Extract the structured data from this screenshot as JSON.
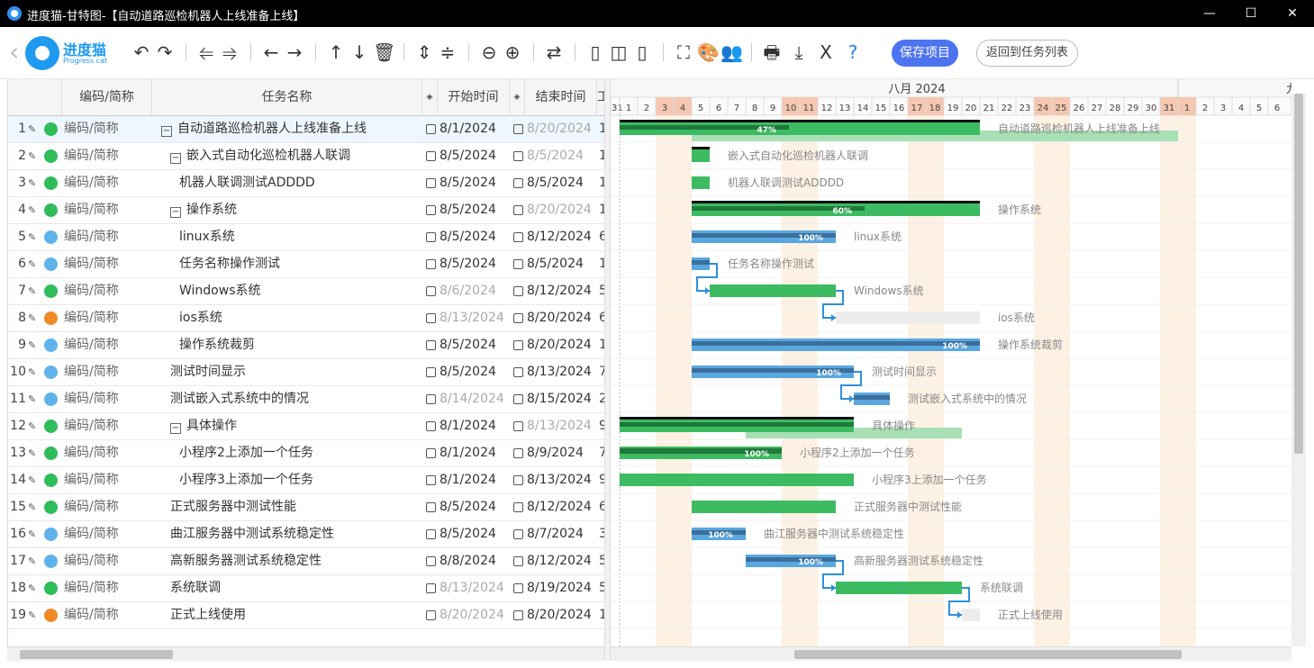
{
  "window": {
    "title": "进度猫-甘特图-【自动道路巡检机器人上线准备上线】",
    "controls": [
      "—",
      "☐",
      "✕"
    ]
  },
  "logo": {
    "name": "进度猫",
    "sub": "Progress cat"
  },
  "toolbar": {
    "save_label": "保存项目",
    "back_label": "返回到任务列表"
  },
  "grid": {
    "headers": [
      "编码/简称",
      "任务名称",
      "开始时间",
      "结束时间",
      "工"
    ]
  },
  "rows": [
    {
      "num": "1",
      "status": "#2ebd59",
      "code": "编码/简称",
      "name": "自动道路巡检机器人上线准备上线",
      "indent": 0,
      "toggle": "−",
      "start": "8/1/2024",
      "start_grey": false,
      "end": "8/20/2024",
      "end_grey": true,
      "work": "1",
      "selected": true
    },
    {
      "num": "2",
      "status": "#2ebd59",
      "code": "编码/简称",
      "name": "嵌入式自动化巡检机器人联调",
      "indent": 1,
      "toggle": "−",
      "start": "8/5/2024",
      "start_grey": false,
      "end": "8/5/2024",
      "end_grey": true,
      "work": "1"
    },
    {
      "num": "3",
      "status": "#2ebd59",
      "code": "编码/简称",
      "name": "机器人联调测试ADDDD",
      "indent": 2,
      "toggle": "",
      "start": "8/5/2024",
      "start_grey": false,
      "end": "8/5/2024",
      "end_grey": false,
      "work": "1"
    },
    {
      "num": "4",
      "status": "#2ebd59",
      "code": "编码/简称",
      "name": "操作系统",
      "indent": 1,
      "toggle": "−",
      "start": "8/5/2024",
      "start_grey": false,
      "end": "8/20/2024",
      "end_grey": true,
      "work": "1"
    },
    {
      "num": "5",
      "status": "#5fb3ea",
      "code": "编码/简称",
      "name": "linux系统",
      "indent": 2,
      "toggle": "",
      "start": "8/5/2024",
      "start_grey": false,
      "end": "8/12/2024",
      "end_grey": false,
      "work": "6"
    },
    {
      "num": "6",
      "status": "#5fb3ea",
      "code": "编码/简称",
      "name": "任务名称操作测试",
      "indent": 2,
      "toggle": "",
      "start": "8/5/2024",
      "start_grey": false,
      "end": "8/5/2024",
      "end_grey": false,
      "work": "1"
    },
    {
      "num": "7",
      "status": "#2ebd59",
      "code": "编码/简称",
      "name": "Windows系统",
      "indent": 2,
      "toggle": "",
      "start": "8/6/2024",
      "start_grey": true,
      "end": "8/12/2024",
      "end_grey": false,
      "work": "5"
    },
    {
      "num": "8",
      "status": "#f08a24",
      "code": "编码/简称",
      "name": "ios系统",
      "indent": 2,
      "toggle": "",
      "start": "8/13/2024",
      "start_grey": true,
      "end": "8/20/2024",
      "end_grey": false,
      "work": "6"
    },
    {
      "num": "9",
      "status": "#5fb3ea",
      "code": "编码/简称",
      "name": "操作系统裁剪",
      "indent": 2,
      "toggle": "",
      "start": "8/5/2024",
      "start_grey": false,
      "end": "8/20/2024",
      "end_grey": false,
      "work": "1"
    },
    {
      "num": "10",
      "status": "#5fb3ea",
      "code": "编码/简称",
      "name": "测试时间显示",
      "indent": 1,
      "toggle": "",
      "start": "8/5/2024",
      "start_grey": false,
      "end": "8/13/2024",
      "end_grey": false,
      "work": "7"
    },
    {
      "num": "11",
      "status": "#5fb3ea",
      "code": "编码/简称",
      "name": "测试嵌入式系统中的情况",
      "indent": 1,
      "toggle": "",
      "start": "8/14/2024",
      "start_grey": true,
      "end": "8/15/2024",
      "end_grey": false,
      "work": "2"
    },
    {
      "num": "12",
      "status": "#2ebd59",
      "code": "编码/简称",
      "name": "具体操作",
      "indent": 1,
      "toggle": "−",
      "start": "8/1/2024",
      "start_grey": false,
      "end": "8/13/2024",
      "end_grey": true,
      "work": "9"
    },
    {
      "num": "13",
      "status": "#2ebd59",
      "code": "编码/简称",
      "name": "小程序2上添加一个任务",
      "indent": 2,
      "toggle": "",
      "start": "8/1/2024",
      "start_grey": false,
      "end": "8/9/2024",
      "end_grey": false,
      "work": "7"
    },
    {
      "num": "14",
      "status": "#2ebd59",
      "code": "编码/简称",
      "name": "小程序3上添加一个任务",
      "indent": 2,
      "toggle": "",
      "start": "8/1/2024",
      "start_grey": false,
      "end": "8/13/2024",
      "end_grey": false,
      "work": "9"
    },
    {
      "num": "15",
      "status": "#2ebd59",
      "code": "编码/简称",
      "name": "正式服务器中测试性能",
      "indent": 1,
      "toggle": "",
      "start": "8/5/2024",
      "start_grey": false,
      "end": "8/12/2024",
      "end_grey": false,
      "work": "6"
    },
    {
      "num": "16",
      "status": "#5fb3ea",
      "code": "编码/简称",
      "name": "曲江服务器中测试系统稳定性",
      "indent": 1,
      "toggle": "",
      "start": "8/5/2024",
      "start_grey": false,
      "end": "8/7/2024",
      "end_grey": false,
      "work": "3"
    },
    {
      "num": "17",
      "status": "#5fb3ea",
      "code": "编码/简称",
      "name": "高新服务器测试系统稳定性",
      "indent": 1,
      "toggle": "",
      "start": "8/8/2024",
      "start_grey": false,
      "end": "8/12/2024",
      "end_grey": false,
      "work": "5"
    },
    {
      "num": "18",
      "status": "#2ebd59",
      "code": "编码/简称",
      "name": "系统联调",
      "indent": 1,
      "toggle": "",
      "start": "8/13/2024",
      "start_grey": true,
      "end": "8/19/2024",
      "end_grey": false,
      "work": "5"
    },
    {
      "num": "19",
      "status": "#f08a24",
      "code": "编码/简称",
      "name": "正式上线使用",
      "indent": 1,
      "toggle": "",
      "start": "8/20/2024",
      "start_grey": true,
      "end": "8/20/2024",
      "end_grey": false,
      "work": "1"
    }
  ],
  "timeline": {
    "month_label": "八月 2024",
    "next_month_fragment": "九",
    "first_day_label": "31",
    "days": [
      "1",
      "2",
      "3",
      "4",
      "5",
      "6",
      "7",
      "8",
      "9",
      "10",
      "11",
      "12",
      "13",
      "14",
      "15",
      "16",
      "17",
      "18",
      "19",
      "20",
      "21",
      "22",
      "23",
      "24",
      "25",
      "26",
      "27",
      "28",
      "29",
      "30",
      "31",
      "1",
      "2",
      "3",
      "4",
      "5",
      "6"
    ],
    "weekend_days": [
      3,
      4,
      10,
      11,
      17,
      18,
      24,
      25,
      31,
      32
    ],
    "colors": {
      "weekend_head": "#f5c7b0",
      "weekend_col": "#fdf1e3",
      "green": "#3dbb62",
      "dark_green": "#1f7a3a",
      "blue": "#5aa7e0",
      "dark_blue": "#3b6f9c",
      "light_green": "#a8dfb5",
      "grey_bar": "#ececec"
    }
  },
  "bars": [
    {
      "row": 0,
      "start": 1,
      "end": 20,
      "type": "summary",
      "progress_label": "47%",
      "progress": 0.47,
      "label": "自动道路巡检机器人上线准备上线",
      "baseline_start": 5,
      "baseline_end": 31
    },
    {
      "row": 1,
      "start": 5,
      "end": 5,
      "type": "summary",
      "progress_label": "",
      "progress": 0,
      "label": "嵌入式自动化巡检机器人联调"
    },
    {
      "row": 2,
      "start": 5,
      "end": 5,
      "type": "green",
      "progress_label": "",
      "progress": 0,
      "label": "机器人联调测试ADDDD"
    },
    {
      "row": 3,
      "start": 5,
      "end": 20,
      "type": "summary",
      "progress_label": "60%",
      "progress": 0.6,
      "label": "操作系统"
    },
    {
      "row": 4,
      "start": 5,
      "end": 12,
      "type": "blue",
      "progress_label": "100%",
      "progress": 1,
      "label": "linux系统"
    },
    {
      "row": 5,
      "start": 5,
      "end": 5,
      "type": "blue",
      "progress_label": "",
      "progress": 1,
      "label": "任务名称操作测试"
    },
    {
      "row": 6,
      "start": 6,
      "end": 12,
      "type": "green",
      "progress_label": "",
      "progress": 0,
      "label": "Windows系统"
    },
    {
      "row": 7,
      "start": 13,
      "end": 20,
      "type": "grey",
      "progress_label": "",
      "progress": 0,
      "label": "ios系统"
    },
    {
      "row": 8,
      "start": 5,
      "end": 20,
      "type": "blue",
      "progress_label": "100%",
      "progress": 1,
      "label": "操作系统裁剪"
    },
    {
      "row": 9,
      "start": 5,
      "end": 13,
      "type": "blue",
      "progress_label": "100%",
      "progress": 1,
      "label": "测试时间显示"
    },
    {
      "row": 10,
      "start": 14,
      "end": 15,
      "type": "blue",
      "progress_label": "",
      "progress": 1,
      "label": "测试嵌入式系统中的情况"
    },
    {
      "row": 11,
      "start": 1,
      "end": 13,
      "type": "summary",
      "progress_label": "",
      "progress": 1,
      "label": "具体操作",
      "baseline_start": 8,
      "baseline_end": 19
    },
    {
      "row": 12,
      "start": 1,
      "end": 9,
      "type": "darkgreen",
      "progress_label": "100%",
      "progress": 1,
      "label": "小程序2上添加一个任务"
    },
    {
      "row": 13,
      "start": 1,
      "end": 13,
      "type": "green",
      "progress_label": "",
      "progress": 0,
      "label": "小程序3上添加一个任务"
    },
    {
      "row": 14,
      "start": 5,
      "end": 12,
      "type": "green",
      "progress_label": "",
      "progress": 0,
      "label": "正式服务器中测试性能"
    },
    {
      "row": 15,
      "start": 5,
      "end": 7,
      "type": "blue",
      "progress_label": "100%",
      "progress": 1,
      "label": "曲江服务器中测试系统稳定性"
    },
    {
      "row": 16,
      "start": 8,
      "end": 12,
      "type": "blue",
      "progress_label": "100%",
      "progress": 1,
      "label": "高新服务器测试系统稳定性"
    },
    {
      "row": 17,
      "start": 13,
      "end": 19,
      "type": "green",
      "progress_label": "",
      "progress": 0,
      "label": "系统联调"
    },
    {
      "row": 18,
      "start": 20,
      "end": 20,
      "type": "grey",
      "progress_label": "",
      "progress": 0,
      "label": "正式上线使用"
    }
  ],
  "links": [
    {
      "from": 5,
      "to": 6
    },
    {
      "from": 6,
      "to": 7
    },
    {
      "from": 9,
      "to": 10
    },
    {
      "from": 16,
      "to": 17
    },
    {
      "from": 17,
      "to": 18
    }
  ]
}
